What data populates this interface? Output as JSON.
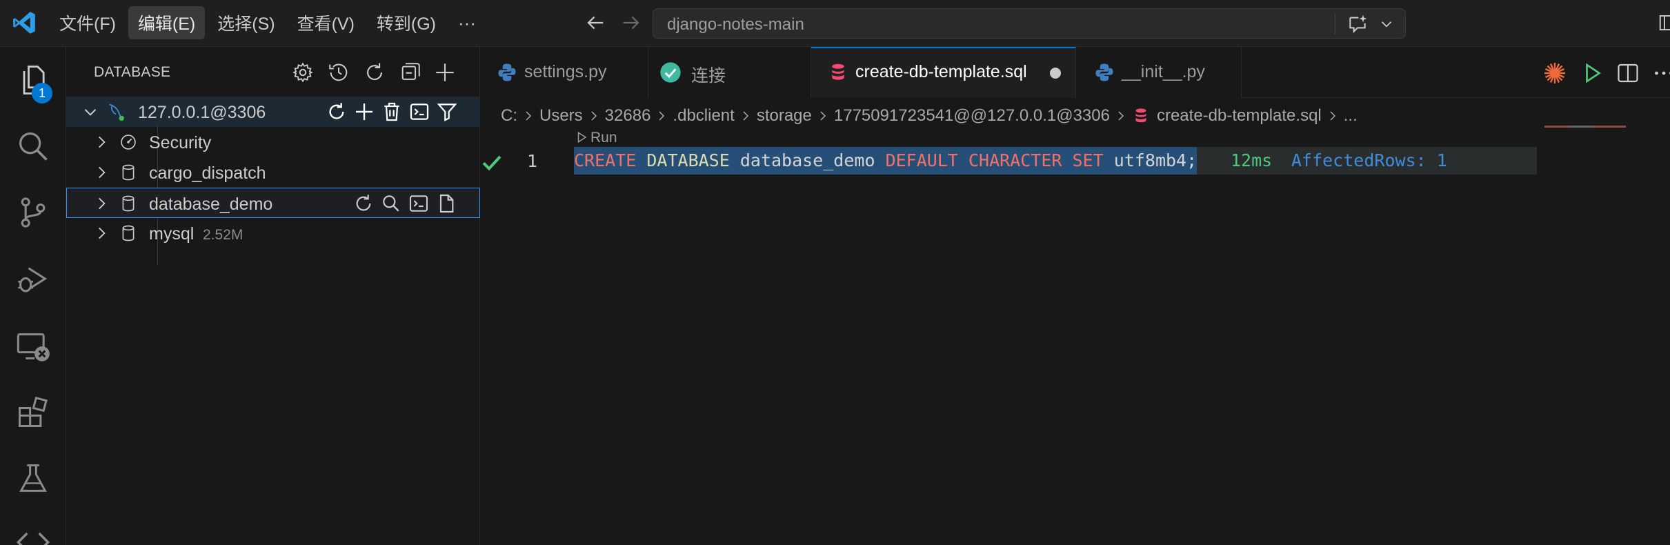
{
  "menubar": {
    "items": [
      "文件(F)",
      "编辑(E)",
      "选择(S)",
      "查看(V)",
      "转到(G)"
    ],
    "active_index": 1,
    "more": "···"
  },
  "command_center": {
    "text": "django-notes-main"
  },
  "activity_bar": {
    "explorer_badge": "1"
  },
  "sidebar": {
    "title": "DATABASE",
    "connection": {
      "label": "127.0.0.1@3306",
      "status_color": "#3fb950"
    },
    "items": [
      {
        "label": "Security",
        "size": ""
      },
      {
        "label": "cargo_dispatch",
        "size": ""
      },
      {
        "label": "database_demo",
        "size": ""
      },
      {
        "label": "mysql",
        "size": "2.52M"
      }
    ]
  },
  "tabs": [
    {
      "label": "settings.py",
      "icon": "python-icon"
    },
    {
      "label": "连接",
      "icon": "check-circle-icon"
    },
    {
      "label": "create-db-template.sql",
      "icon": "database-icon",
      "active": true,
      "dirty": true
    },
    {
      "label": "__init__.py",
      "icon": "python-icon"
    }
  ],
  "breadcrumb": [
    "C:",
    "Users",
    "32686",
    ".dbclient",
    "storage",
    "1775091723541@@127.0.0.1@3306",
    "create-db-template.sql",
    "..."
  ],
  "editor": {
    "codelens": "Run",
    "line_number": "1",
    "code_tokens": [
      {
        "text": "CREATE",
        "kind": "kw"
      },
      {
        "text": " ",
        "kind": "plain"
      },
      {
        "text": "DATABASE",
        "kind": "fn"
      },
      {
        "text": " database_demo ",
        "kind": "plain"
      },
      {
        "text": "DEFAULT",
        "kind": "kw"
      },
      {
        "text": " ",
        "kind": "plain"
      },
      {
        "text": "CHARACTER",
        "kind": "kw"
      },
      {
        "text": " ",
        "kind": "plain"
      },
      {
        "text": "SET",
        "kind": "kw"
      },
      {
        "text": " utf8mb4;",
        "kind": "plain"
      }
    ],
    "timing": "12ms",
    "affected_rows": "AffectedRows: 1"
  },
  "colors": {
    "accent": "#0078d4",
    "keyword": "#f47067",
    "success": "#4ec97c",
    "info": "#3f8cdb"
  }
}
